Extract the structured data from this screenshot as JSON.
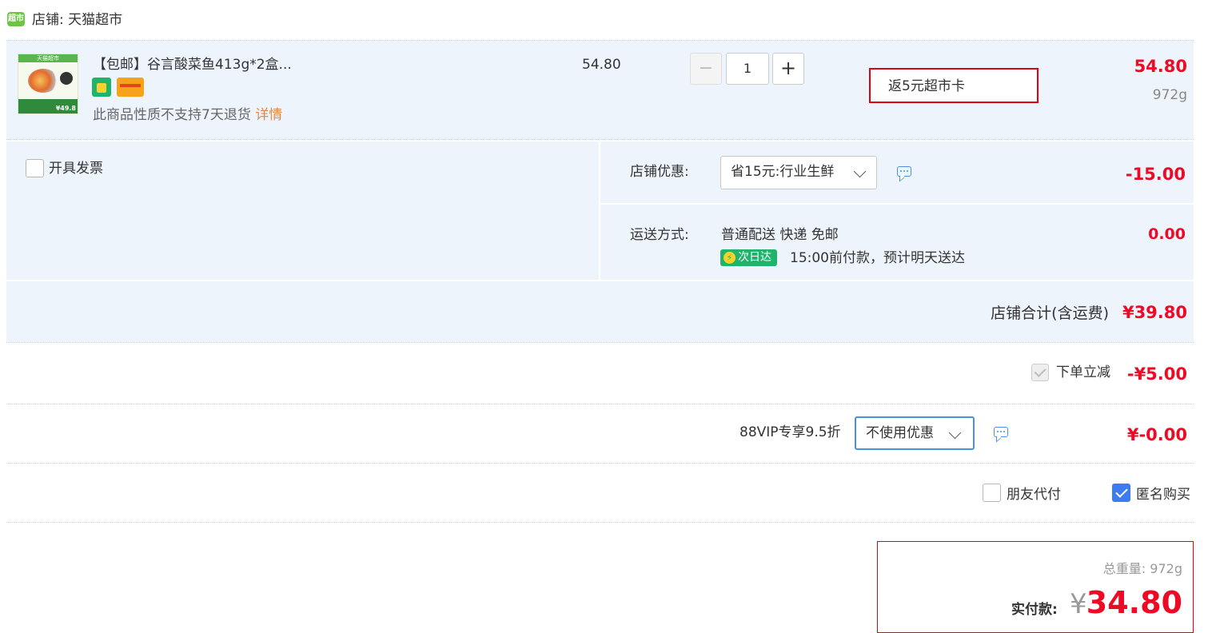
{
  "store": {
    "label": "店铺: 天猫超市",
    "logo_text": "超市"
  },
  "item": {
    "thumb_header": "天猫超市",
    "thumb_price": "¥49.8",
    "title": "【包邮】谷言酸菜鱼413g*2盒...",
    "unit_price": "54.80",
    "quantity": "1",
    "minus": "−",
    "plus": "+",
    "rebate": "返5元超市卡",
    "total": "54.80",
    "weight": "972g",
    "return_policy": "此商品性质不支持7天退货",
    "details_link": "详情"
  },
  "invoice": {
    "label": "开具发票"
  },
  "store_discount": {
    "label": "店铺优惠:",
    "selected": "省15元:行业生鲜",
    "amount": "-15.00"
  },
  "shipping": {
    "label": "运送方式:",
    "method": "普通配送 快递 免邮",
    "amount": "0.00",
    "badge": "次日达",
    "note": "15:00前付款，预计明天送达"
  },
  "store_total": {
    "label": "店铺合计(含运费)",
    "amount": "¥39.80"
  },
  "instant_discount": {
    "label": "下单立减",
    "amount": "-¥5.00"
  },
  "vip": {
    "label": "88VIP专享9.5折",
    "selected": "不使用优惠",
    "amount": "¥-0.00"
  },
  "options": {
    "friend_pay": "朋友代付",
    "anonymous": "匿名购买"
  },
  "summary": {
    "weight_label": "总重量:",
    "weight": "972g",
    "pay_label": "实付款:",
    "currency": "¥",
    "amount": "34.80"
  },
  "colors": {
    "accent": "#ee0a24",
    "light_bg": "#eef4fc",
    "check_blue": "#3c7bf0",
    "badge_green": "#1fb36b"
  }
}
